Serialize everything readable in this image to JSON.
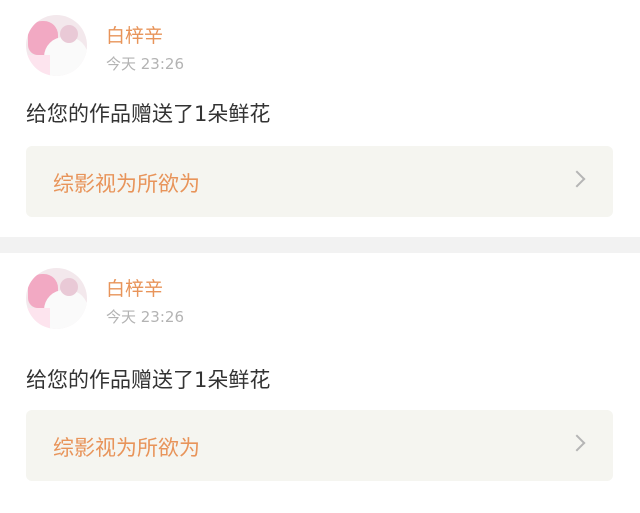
{
  "notifications": [
    {
      "username": "白梓辛",
      "time": "今天 23:26",
      "message": "给您的作品赠送了1朵鲜花",
      "work_title": "综影视为所欲为"
    },
    {
      "username": "白梓辛",
      "time": "今天 23:26",
      "message": "给您的作品赠送了1朵鲜花",
      "work_title": "综影视为所欲为"
    }
  ],
  "icons": {
    "avatar": "user-avatar-photo",
    "chevron": "chevron-right-icon"
  },
  "colors": {
    "username": "#e8945a",
    "work_title": "#e8945a",
    "time": "#b3b3b3",
    "message": "#333333",
    "link_background": "#f5f5f0",
    "separator": "#f2f2f2"
  }
}
